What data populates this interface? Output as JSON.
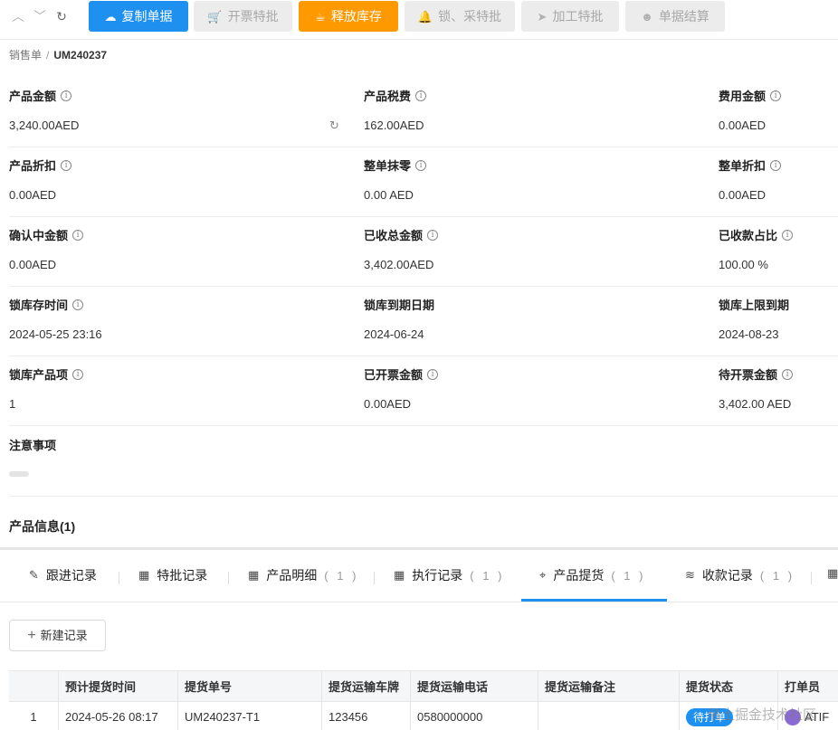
{
  "toolbar": {
    "copy_label": "复制单据",
    "invoice_label": "开票特批",
    "release_label": "释放库存",
    "lock_label": "锁、采特批",
    "process_label": "加工特批",
    "settle_label": "单据结算"
  },
  "breadcrumb": {
    "parent": "销售单",
    "separator": "/",
    "current": "UM240237"
  },
  "fields": {
    "product_amount": {
      "label": "产品金额",
      "value": "3,240.00AED"
    },
    "product_tax": {
      "label": "产品税费",
      "value": "162.00AED"
    },
    "fee_amount": {
      "label": "费用金额",
      "value": "0.00AED"
    },
    "product_discount": {
      "label": "产品折扣",
      "value": "0.00AED"
    },
    "order_rounding": {
      "label": "整单抹零",
      "value": "0.00 AED"
    },
    "order_discount": {
      "label": "整单折扣",
      "value": "0.00AED"
    },
    "confirming_amount": {
      "label": "确认中金额",
      "value": "0.00AED"
    },
    "received_total": {
      "label": "已收总金额",
      "value": "3,402.00AED"
    },
    "received_ratio": {
      "label": "已收款占比",
      "value": "100.00 %"
    },
    "lock_time": {
      "label": "锁库存时间",
      "value": "2024-05-25 23:16"
    },
    "lock_expiry": {
      "label": "锁库到期日期",
      "value": "2024-06-24"
    },
    "lock_limit": {
      "label": "锁库上限到期",
      "value": "2024-08-23"
    },
    "lock_items": {
      "label": "锁库产品项",
      "value": "1"
    },
    "invoiced_amount": {
      "label": "已开票金额",
      "value": "0.00AED"
    },
    "pending_invoice": {
      "label": "待开票金额",
      "value": "3,402.00 AED"
    },
    "notes": {
      "label": "注意事项"
    }
  },
  "section": {
    "product_info": "产品信息(1)"
  },
  "tabs": [
    {
      "label": "跟进记录",
      "icon": "edit-icon",
      "count": ""
    },
    {
      "label": "特批记录",
      "icon": "grid-icon",
      "count": ""
    },
    {
      "label": "产品明细",
      "icon": "grid-icon",
      "count": "( 1 )"
    },
    {
      "label": "执行记录",
      "icon": "grid-icon",
      "count": "( 1 )"
    },
    {
      "label": "产品提货",
      "icon": "pickup-icon",
      "count": "( 1 )",
      "active": true
    },
    {
      "label": "收款记录",
      "icon": "coins-icon",
      "count": "( 1 )"
    }
  ],
  "new_record_label": "新建记录",
  "table": {
    "headers": [
      "预计提货时间",
      "提货单号",
      "提货运输车牌",
      "提货运输电话",
      "提货运输备注",
      "提货状态",
      "打单员"
    ],
    "rows": [
      {
        "index": "1",
        "time": "2024-05-26 08:17",
        "order_no": "UM240237-T1",
        "plate": "123456",
        "phone": "0580000000",
        "remark": "",
        "status": "待打单",
        "printer": "ATIF"
      }
    ]
  },
  "watermark": "稀土掘金技术社区",
  "colors": {
    "primary": "#1e90f0",
    "orange": "#ff9900",
    "disabled_bg": "#ececec"
  }
}
